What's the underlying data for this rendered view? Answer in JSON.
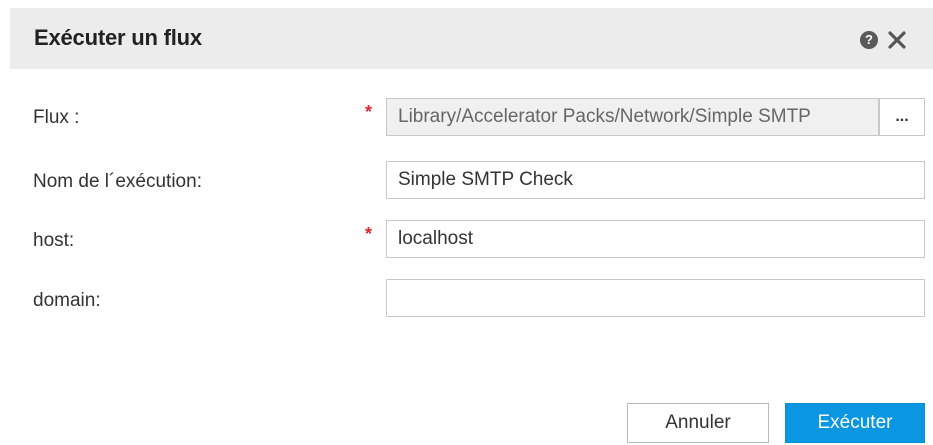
{
  "dialog": {
    "title": "Exécuter un flux",
    "help_icon": "question-circle-icon",
    "close_icon": "close-x-icon"
  },
  "form": {
    "flow": {
      "label": "Flux :",
      "required_mark": "*",
      "value": "Library/Accelerator Packs/Network/Simple SMTP",
      "browse_label": "..."
    },
    "run_name": {
      "label": "Nom de l´exécution:",
      "value": "Simple SMTP Check"
    },
    "host": {
      "label": "host:",
      "required_mark": "*",
      "value": "localhost"
    },
    "domain": {
      "label": "domain:",
      "value": ""
    }
  },
  "actions": {
    "cancel_label": "Annuler",
    "run_label": "Exécuter"
  },
  "colors": {
    "header_bg": "#ececec",
    "required": "#e3242b",
    "primary_button": "#0a96e0"
  }
}
